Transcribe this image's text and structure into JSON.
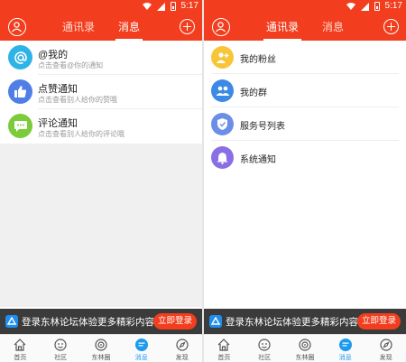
{
  "status": {
    "time": "5:17"
  },
  "left": {
    "tabs": [
      {
        "label": "通讯录",
        "active": false
      },
      {
        "label": "消息",
        "active": true
      }
    ],
    "items": [
      {
        "title": "@我的",
        "subtitle": "点击查看@你的通知",
        "icon": "at-icon",
        "color": "#2eb3e6"
      },
      {
        "title": "点赞通知",
        "subtitle": "点击查看别人给你的赞哦",
        "icon": "thumbs-up-icon",
        "color": "#4f7fe6"
      },
      {
        "title": "评论通知",
        "subtitle": "点击查看别人给你的评论哦",
        "icon": "comment-icon",
        "color": "#7ccb3a"
      }
    ]
  },
  "right": {
    "tabs": [
      {
        "label": "通讯录",
        "active": true
      },
      {
        "label": "消息",
        "active": false
      }
    ],
    "items": [
      {
        "title": "我的粉丝",
        "icon": "fans-icon",
        "color": "#f8c536"
      },
      {
        "title": "我的群",
        "icon": "group-icon",
        "color": "#3d8ae6"
      },
      {
        "title": "服务号列表",
        "icon": "shield-check-icon",
        "color": "#6b8fe6"
      },
      {
        "title": "系统通知",
        "icon": "bell-icon",
        "color": "#8a6ee6"
      }
    ]
  },
  "login_bar": {
    "message": "登录东林论坛体验更多精彩内容",
    "button": "立即登录"
  },
  "tabbar": [
    {
      "label": "首页",
      "icon": "home-icon",
      "active": false
    },
    {
      "label": "社区",
      "icon": "community-icon",
      "active": false
    },
    {
      "label": "东林圈",
      "icon": "circle-icon",
      "active": false
    },
    {
      "label": "消息",
      "icon": "message-icon",
      "active": true
    },
    {
      "label": "发现",
      "icon": "discover-icon",
      "active": false
    }
  ],
  "colors": {
    "brand": "#f23e1e",
    "active_tab": "#1b9af0",
    "login_bar": "#3b3b3b"
  }
}
